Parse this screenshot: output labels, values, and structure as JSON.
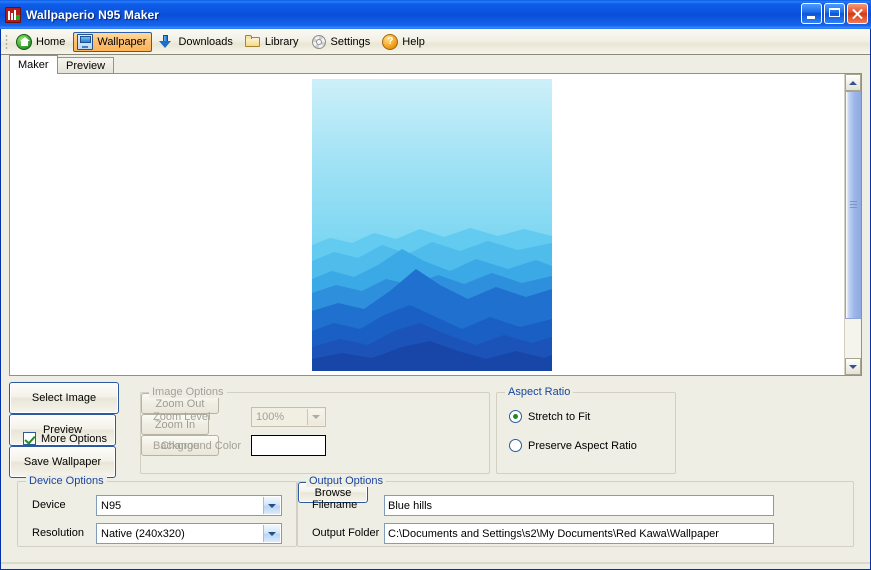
{
  "window": {
    "title": "Wallpaperio N95 Maker",
    "icon": "app-chart-icon",
    "minimize_label": "Minimize",
    "maximize_label": "Maximize",
    "close_label": "Close"
  },
  "toolbar": {
    "items": [
      {
        "label": "Home",
        "icon": "home-icon",
        "active": false
      },
      {
        "label": "Wallpaper",
        "icon": "monitor-icon",
        "active": true
      },
      {
        "label": "Downloads",
        "icon": "download-arrow-icon",
        "active": false
      },
      {
        "label": "Library",
        "icon": "folder-icon",
        "active": false
      },
      {
        "label": "Settings",
        "icon": "gear-icon",
        "active": false
      },
      {
        "label": "Help",
        "icon": "question-mark-icon",
        "active": false
      }
    ]
  },
  "tabs": [
    {
      "label": "Maker",
      "active": true
    },
    {
      "label": "Preview",
      "active": false
    }
  ],
  "preview": {
    "image_title": "Blue hills",
    "sky_top_color": "#c9eef8",
    "sky_bottom_color": "#58c6ef",
    "hill_colors": [
      "#63caf0",
      "#4fbcec",
      "#3aa9e6",
      "#2e8fdc",
      "#2070d0",
      "#1a5fc4",
      "#1b53b8",
      "#1746a8"
    ]
  },
  "scrollbar": {
    "up_arrow": "scroll-up-icon",
    "down_arrow": "scroll-down-icon"
  },
  "actions": {
    "select_image": "Select Image",
    "more_options_label": "More Options",
    "more_options_checked": true,
    "preview": "Preview",
    "save_wallpaper": "Save Wallpaper",
    "browse": "Browse"
  },
  "image_options": {
    "legend": "Image Options",
    "enabled": false,
    "zoom_level_label": "Zoom Level",
    "zoom_level_value": "100%",
    "background_color_label": "Background Color",
    "background_color_value": "#ffffff",
    "zoom_out": "Zoom Out",
    "zoom_in": "Zoom In",
    "change": "Change"
  },
  "aspect_ratio": {
    "legend": "Aspect Ratio",
    "options": [
      {
        "label": "Stretch to Fit",
        "selected": true
      },
      {
        "label": "Preserve Aspect Ratio",
        "selected": false
      }
    ]
  },
  "device_options": {
    "legend": "Device Options",
    "device_label": "Device",
    "device_value": "N95",
    "resolution_label": "Resolution",
    "resolution_value": "Native (240x320)"
  },
  "output_options": {
    "legend": "Output Options",
    "filename_label": "Filename",
    "filename_value": "Blue hills",
    "output_folder_label": "Output Folder",
    "output_folder_value": "C:\\Documents and Settings\\s2\\My Documents\\Red Kawa\\Wallpaper"
  }
}
